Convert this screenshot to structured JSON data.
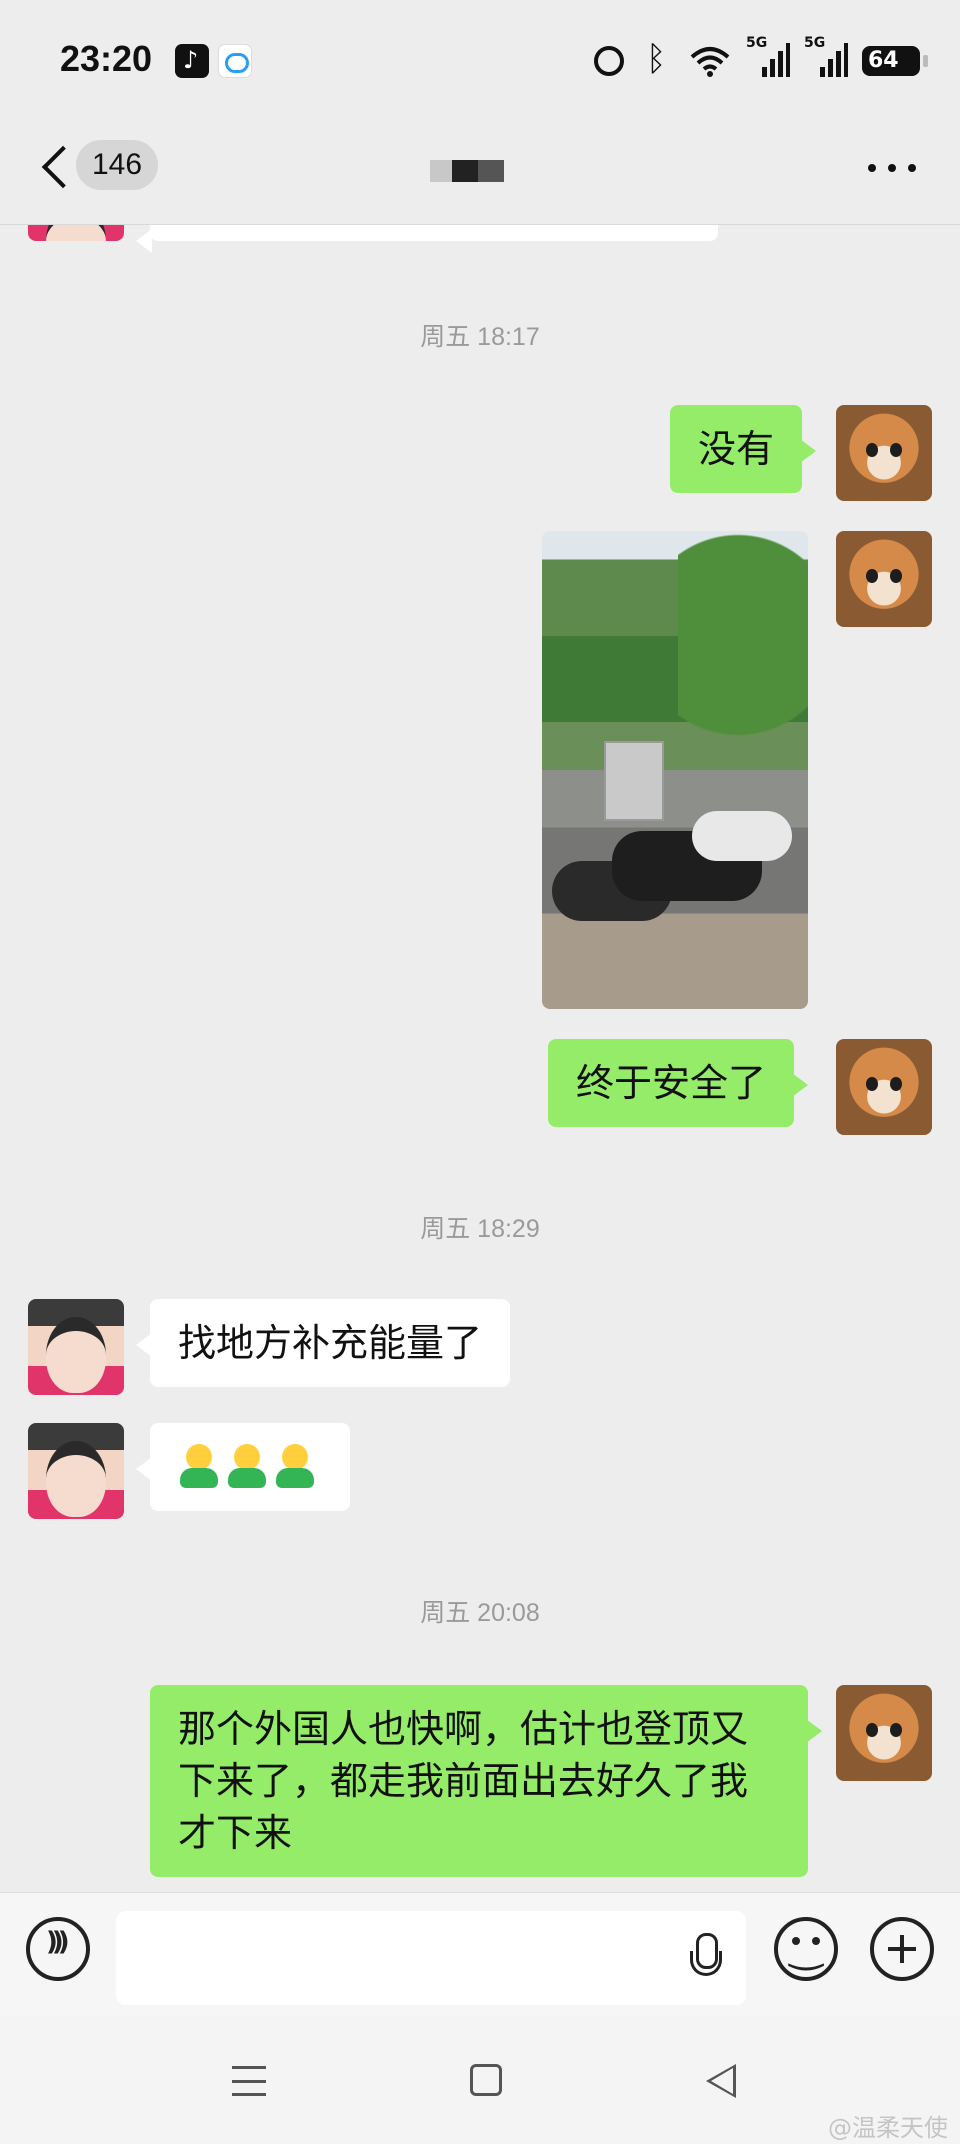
{
  "status_bar": {
    "time": "23:20",
    "apps": [
      "tiktok-icon",
      "chat-app-icon"
    ],
    "network_label_1": "5G",
    "network_label_2": "5G",
    "battery_level": "64"
  },
  "nav": {
    "unread_count": "146",
    "title_obscured": true
  },
  "messages": [
    {
      "type": "timestamp",
      "text": "周五 18:17"
    },
    {
      "type": "text",
      "sender": "self",
      "text": "没有"
    },
    {
      "type": "image",
      "sender": "self",
      "content": "scooters parked under trees"
    },
    {
      "type": "text",
      "sender": "self",
      "text": "终于安全了"
    },
    {
      "type": "timestamp",
      "text": "周五 18:29"
    },
    {
      "type": "text",
      "sender": "other",
      "text": "找地方补充能量了"
    },
    {
      "type": "emoji",
      "sender": "other",
      "count": 3
    },
    {
      "type": "timestamp",
      "text": "周五 20:08"
    },
    {
      "type": "text",
      "sender": "self",
      "text": "那个外国人也快啊，估计也登顶又下来了，都走我前面出去好久了我才下来"
    }
  ],
  "input": {
    "value": "",
    "placeholder": ""
  },
  "watermark": "@温柔天使",
  "colors": {
    "background": "#ededed",
    "self_bubble": "#95ec69",
    "other_bubble": "#ffffff",
    "timestamp": "#9a9a9a"
  }
}
